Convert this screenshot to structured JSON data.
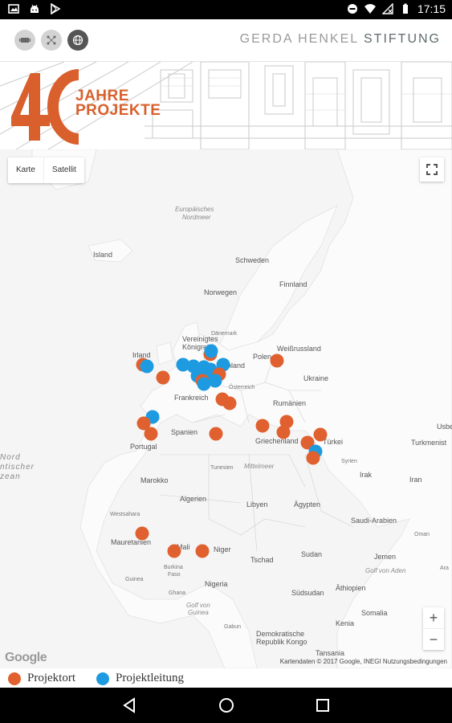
{
  "status_bar": {
    "time": "17:15",
    "icons_left": [
      "image-icon",
      "android-icon",
      "play-store-icon"
    ],
    "icons_right": [
      "minus-circle-icon",
      "wifi-icon",
      "no-signal-icon",
      "battery-icon"
    ]
  },
  "header": {
    "buttons": [
      "gallery-view-icon",
      "network-view-icon",
      "globe-view-icon"
    ],
    "brand_light": "GERDA HENKEL ",
    "brand_dark": "STIFTUNG"
  },
  "banner": {
    "number": "40",
    "line1": "JAHRE",
    "line2": "PROJEKTE"
  },
  "map": {
    "map_type_buttons": [
      "Karte",
      "Satellit"
    ],
    "zoom_in": "+",
    "zoom_out": "−",
    "google_logo": "Google",
    "attribution": "Kartendaten © 2017 Google, INEGI   Nutzungsbedingungen",
    "labels": {
      "europ_nordmeer_1": "Europäisches",
      "europ_nordmeer_2": "Nordmeer",
      "island": "Island",
      "schweden": "Schweden",
      "finnland": "Finnland",
      "norwegen": "Norwegen",
      "vk1": "Vereinigtes",
      "vk2": "Königreich",
      "daenemark": "Dänemark",
      "irland": "Irland",
      "polen": "Polen",
      "weissrussland": "Weißrussland",
      "deutschland": "Deutschland",
      "ukraine": "Ukraine",
      "frankreich": "Frankreich",
      "oesterreich": "Österreich",
      "rumaenien": "Rumänien",
      "spanien": "Spanien",
      "portugal": "Portugal",
      "griechenland": "Griechenland",
      "tuerkei": "Türkei",
      "syrien": "Syrien",
      "irak": "Irak",
      "iran": "Iran",
      "usbekistan": "Usbe",
      "turkmenistan": "Turkmenist",
      "marokko": "Marokko",
      "tunesien": "Tunesien",
      "mittelmeer": "Mittelmeer",
      "algerien": "Algerien",
      "libyen": "Libyen",
      "aegypten": "Ägypten",
      "saudi": "Saudi-Arabien",
      "westsahara": "Westsahara",
      "mauretanien": "Mauretanien",
      "mali": "Mali",
      "niger": "Niger",
      "tschad": "Tschad",
      "sudan": "Sudan",
      "jemen": "Jemen",
      "oman": "Oman",
      "golf_aden": "Golf von Aden",
      "burkina1": "Burkina",
      "burkina2": "Faso",
      "guinea": "Guinea",
      "ghana": "Ghana",
      "nigeria": "Nigeria",
      "suedsudan": "Südsudan",
      "aethiopien": "Äthiopien",
      "somalia": "Somalia",
      "golf_guinea1": "Golf von",
      "golf_guinea2": "Guinea",
      "gabun": "Gabun",
      "kenia": "Kenia",
      "drk1": "Demokratische",
      "drk2": "Republik Kongo",
      "tansania": "Tansania",
      "ara": "Ara",
      "ocean1": "Nord",
      "ocean2": "ntischer",
      "ocean3": "zean"
    },
    "markers": [
      {
        "type": "ort",
        "lon": 25.0,
        "lat": 53.8
      },
      {
        "type": "ort",
        "lon": -6.3,
        "lat": 53.0
      },
      {
        "type": "ort",
        "lon": -1.5,
        "lat": 50.4
      },
      {
        "type": "ort",
        "lon": 9.5,
        "lat": 55.2
      },
      {
        "type": "leitung",
        "lon": 9.6,
        "lat": 55.8
      },
      {
        "type": "leitung",
        "lon": -5.4,
        "lat": 52.6
      },
      {
        "type": "leitung",
        "lon": 3.0,
        "lat": 53.0
      },
      {
        "type": "leitung",
        "lon": 5.5,
        "lat": 52.7
      },
      {
        "type": "leitung",
        "lon": 8.0,
        "lat": 52.5
      },
      {
        "type": "leitung",
        "lon": 12.5,
        "lat": 53.0
      },
      {
        "type": "leitung",
        "lon": 9.5,
        "lat": 52.0
      },
      {
        "type": "leitung",
        "lon": 7.0,
        "lat": 51.5
      },
      {
        "type": "leitung",
        "lon": 6.5,
        "lat": 50.6
      },
      {
        "type": "leitung",
        "lon": 8.8,
        "lat": 50.3
      },
      {
        "type": "ort",
        "lon": 11.5,
        "lat": 51.0
      },
      {
        "type": "leitung",
        "lon": 10.5,
        "lat": 49.6
      },
      {
        "type": "ort",
        "lon": 7.6,
        "lat": 49.6
      },
      {
        "type": "leitung",
        "lon": 8.0,
        "lat": 49.0
      },
      {
        "type": "ort",
        "lon": 12.2,
        "lat": 45.8
      },
      {
        "type": "ort",
        "lon": 14.0,
        "lat": 45.0
      },
      {
        "type": "leitung",
        "lon": -4.0,
        "lat": 42.2
      },
      {
        "type": "ort",
        "lon": -6.0,
        "lat": 41.0
      },
      {
        "type": "ort",
        "lon": -4.4,
        "lat": 38.8
      },
      {
        "type": "ort",
        "lon": 10.8,
        "lat": 38.8
      },
      {
        "type": "ort",
        "lon": 21.5,
        "lat": 40.5
      },
      {
        "type": "ort",
        "lon": 27.2,
        "lat": 41.2
      },
      {
        "type": "ort",
        "lon": 26.5,
        "lat": 39.0
      },
      {
        "type": "ort",
        "lon": 35.0,
        "lat": 38.5
      },
      {
        "type": "ort",
        "lon": 32.0,
        "lat": 36.9
      },
      {
        "type": "leitung",
        "lon": 34.0,
        "lat": 35.0
      },
      {
        "type": "ort",
        "lon": 33.4,
        "lat": 33.6
      },
      {
        "type": "ort",
        "lon": -6.5,
        "lat": 17.3
      },
      {
        "type": "ort",
        "lon": 1.0,
        "lat": 13.5
      },
      {
        "type": "ort",
        "lon": 7.5,
        "lat": 13.5
      }
    ]
  },
  "legend": [
    {
      "label": "Projektort",
      "color": "#e0612f"
    },
    {
      "label": "Projektleitung",
      "color": "#1e9be0"
    }
  ],
  "nav_bar": [
    "back-icon",
    "home-icon",
    "recents-icon"
  ]
}
